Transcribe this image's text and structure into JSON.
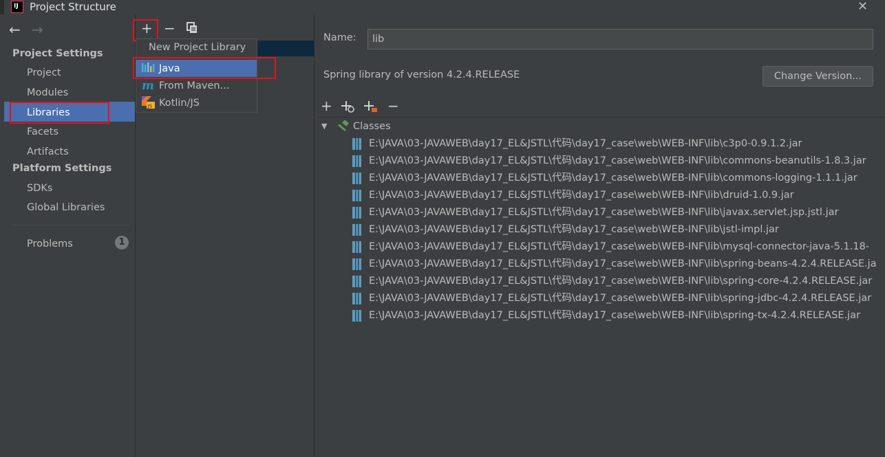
{
  "window": {
    "title": "Project Structure",
    "close_icon": "close-icon"
  },
  "sidebar": {
    "project_settings_header": "Project Settings",
    "project_settings_items": [
      "Project",
      "Modules",
      "Libraries",
      "Facets",
      "Artifacts"
    ],
    "platform_settings_header": "Platform Settings",
    "platform_settings_items": [
      "SDKs",
      "Global Libraries"
    ],
    "problems_label": "Problems",
    "problems_count": "1",
    "selected_item": "Libraries"
  },
  "middle_toolbar": {
    "add_icon": "plus-icon",
    "remove_icon": "minus-icon",
    "copy_icon": "copy-icon"
  },
  "popup": {
    "title": "New Project Library",
    "items": [
      {
        "label": "Java",
        "icon": "java-library-icon"
      },
      {
        "label": "From Maven...",
        "icon": "maven-icon"
      },
      {
        "label": "Kotlin/JS",
        "icon": "kotlin-js-icon"
      }
    ],
    "selected": "Java"
  },
  "details": {
    "name_label": "Name:",
    "name_value": "lib",
    "description": "Spring library of version 4.2.4.RELEASE",
    "change_version_label": "Change Version...",
    "tree_root_label": "Classes",
    "jars": [
      "E:\\JAVA\\03-JAVAWEB\\day17_EL&JSTL\\代码\\day17_case\\web\\WEB-INF\\lib\\c3p0-0.9.1.2.jar",
      "E:\\JAVA\\03-JAVAWEB\\day17_EL&JSTL\\代码\\day17_case\\web\\WEB-INF\\lib\\commons-beanutils-1.8.3.jar",
      "E:\\JAVA\\03-JAVAWEB\\day17_EL&JSTL\\代码\\day17_case\\web\\WEB-INF\\lib\\commons-logging-1.1.1.jar",
      "E:\\JAVA\\03-JAVAWEB\\day17_EL&JSTL\\代码\\day17_case\\web\\WEB-INF\\lib\\druid-1.0.9.jar",
      "E:\\JAVA\\03-JAVAWEB\\day17_EL&JSTL\\代码\\day17_case\\web\\WEB-INF\\lib\\javax.servlet.jsp.jstl.jar",
      "E:\\JAVA\\03-JAVAWEB\\day17_EL&JSTL\\代码\\day17_case\\web\\WEB-INF\\lib\\jstl-impl.jar",
      "E:\\JAVA\\03-JAVAWEB\\day17_EL&JSTL\\代码\\day17_case\\web\\WEB-INF\\lib\\mysql-connector-java-5.1.18-",
      "E:\\JAVA\\03-JAVAWEB\\day17_EL&JSTL\\代码\\day17_case\\web\\WEB-INF\\lib\\spring-beans-4.2.4.RELEASE.ja",
      "E:\\JAVA\\03-JAVAWEB\\day17_EL&JSTL\\代码\\day17_case\\web\\WEB-INF\\lib\\spring-core-4.2.4.RELEASE.jar",
      "E:\\JAVA\\03-JAVAWEB\\day17_EL&JSTL\\代码\\day17_case\\web\\WEB-INF\\lib\\spring-jdbc-4.2.4.RELEASE.jar",
      "E:\\JAVA\\03-JAVAWEB\\day17_EL&JSTL\\代码\\day17_case\\web\\WEB-INF\\lib\\spring-tx-4.2.4.RELEASE.jar"
    ]
  },
  "colors": {
    "background": "#3c3f41",
    "selection": "#4b6eaf",
    "annotation_red": "#e0141b",
    "dark_selection": "#0d293e"
  }
}
